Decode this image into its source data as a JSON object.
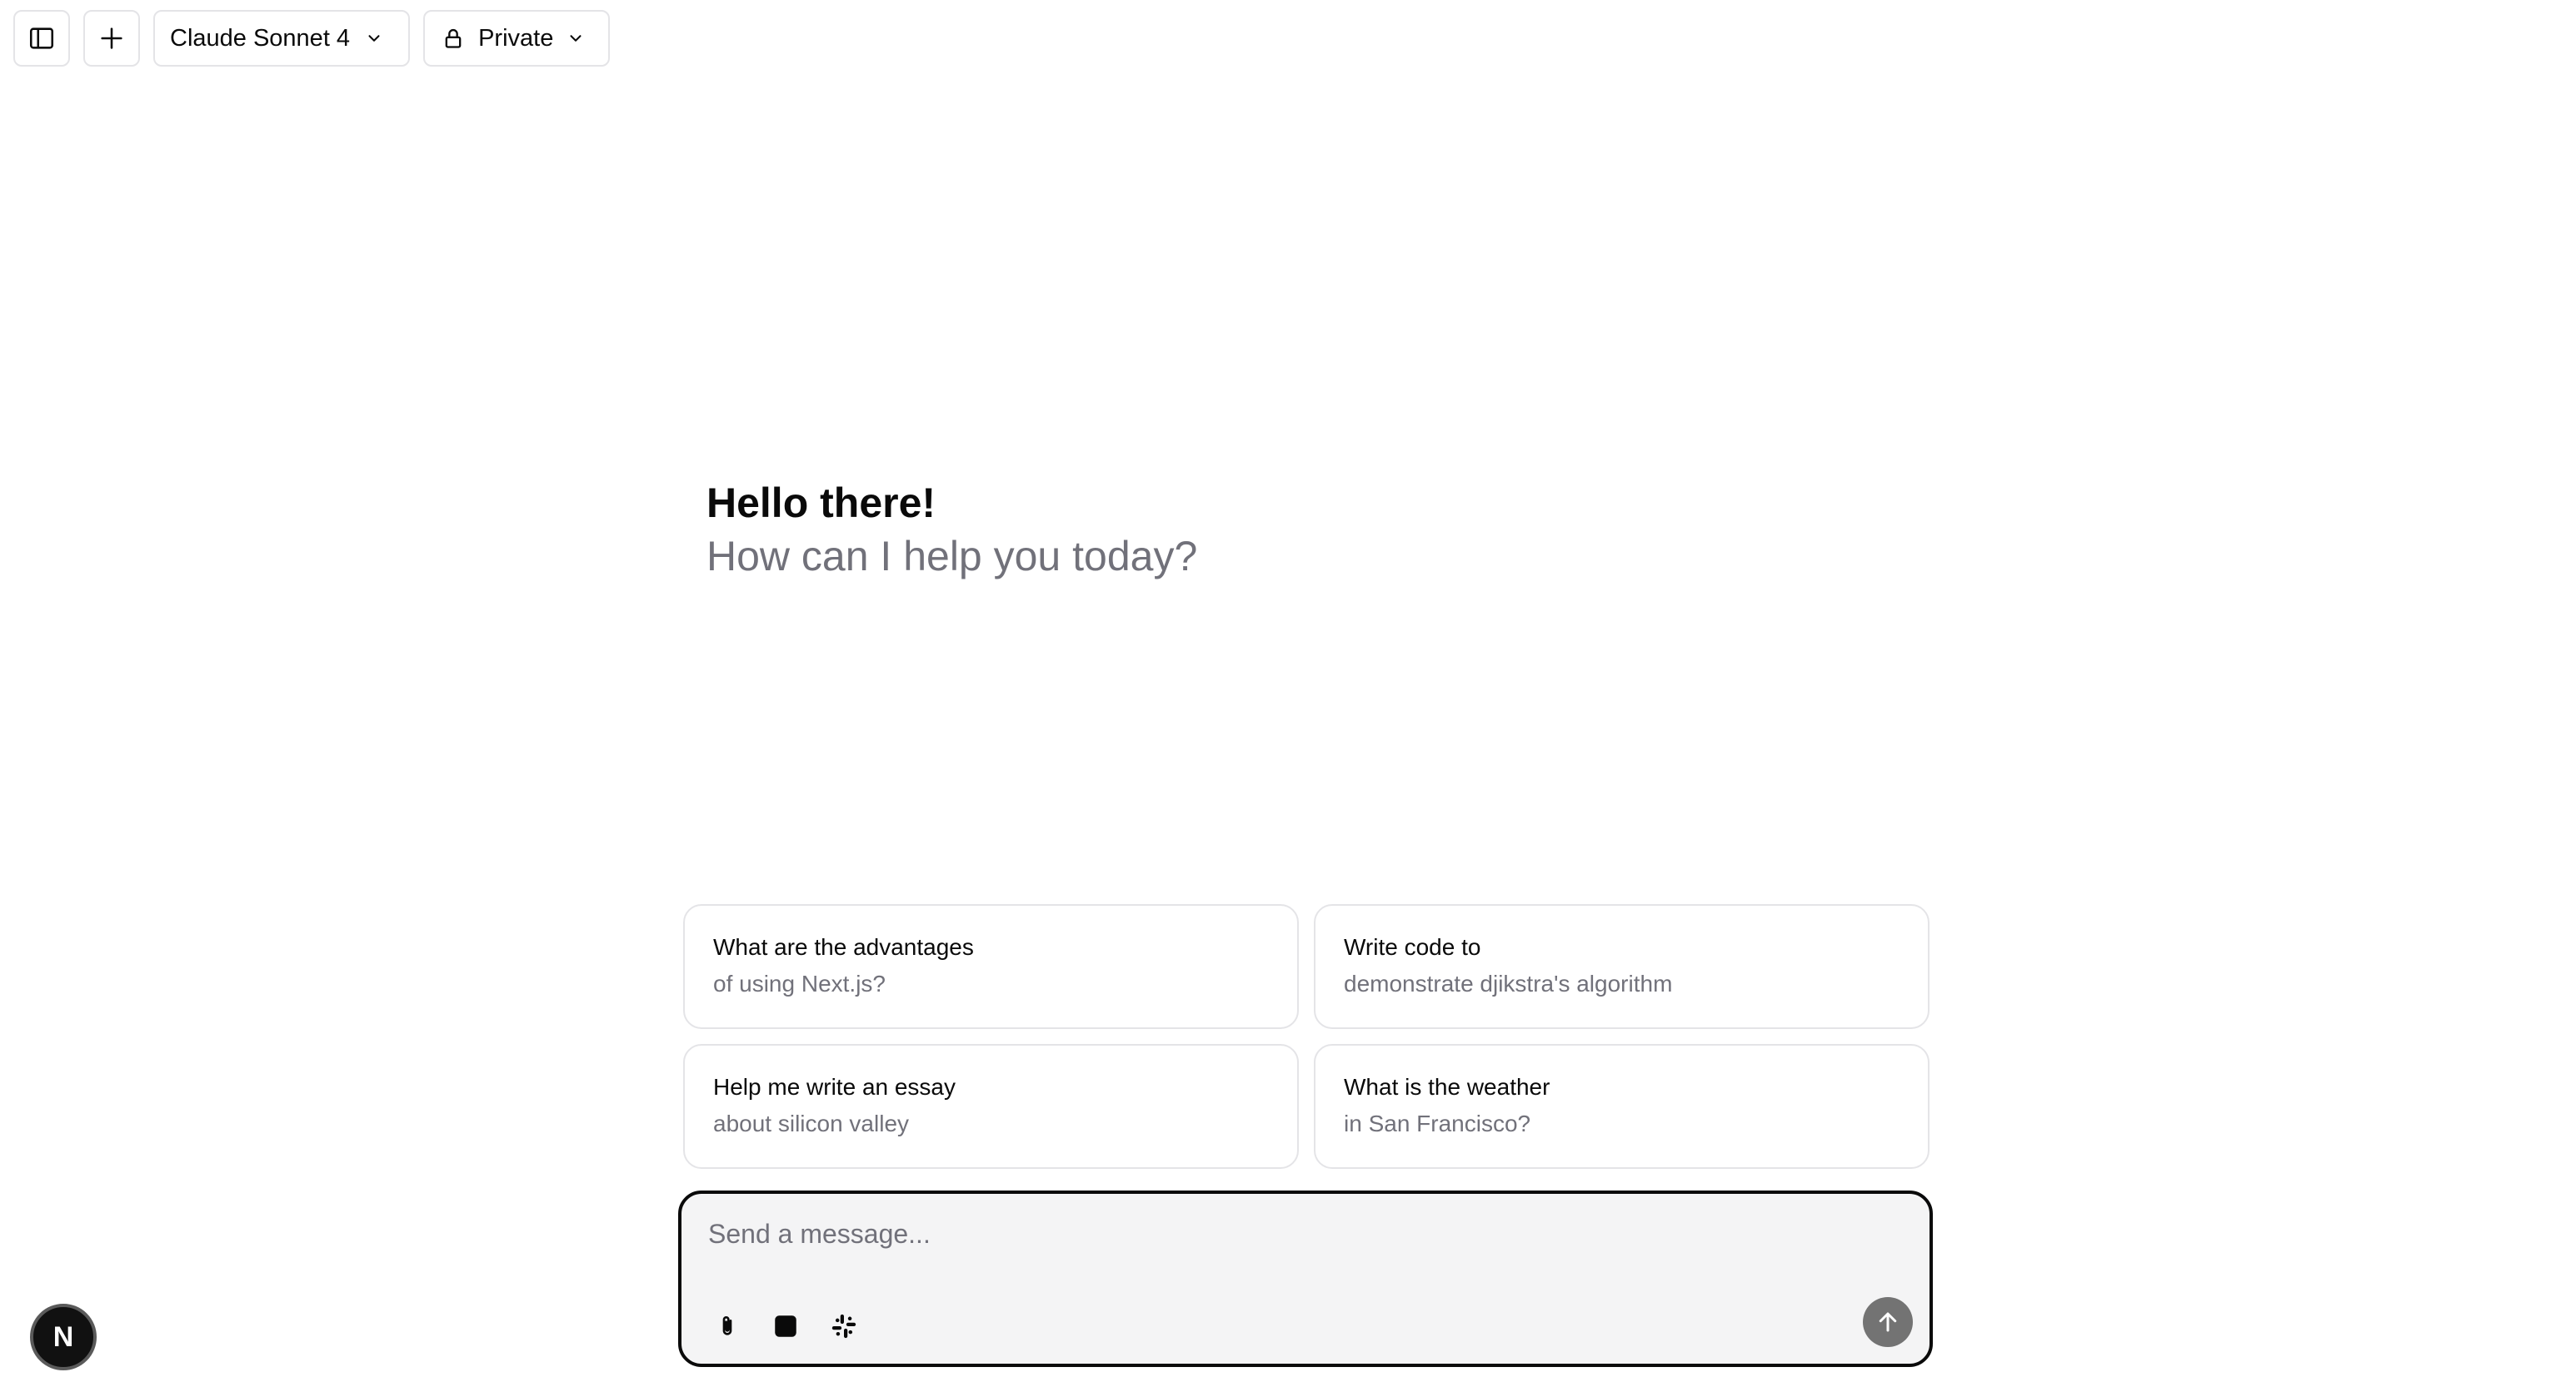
{
  "header": {
    "model_selector": {
      "label": "Claude Sonnet 4"
    },
    "visibility_selector": {
      "label": "Private"
    },
    "icons": [
      "sidebar-toggle-icon",
      "plus-icon",
      "chevron-down-icon",
      "lock-icon"
    ]
  },
  "greeting": {
    "title": "Hello there!",
    "subtitle": "How can I help you today?"
  },
  "suggestions": [
    {
      "title": "What are the advantages",
      "subtitle": "of using Next.js?"
    },
    {
      "title": "Write code to",
      "subtitle": "demonstrate djikstra's algorithm"
    },
    {
      "title": "Help me write an essay",
      "subtitle": "about silicon valley"
    },
    {
      "title": "What is the weather",
      "subtitle": "in San Francisco?"
    }
  ],
  "composer": {
    "placeholder": "Send a message...",
    "value": "",
    "tools": [
      "paperclip-icon",
      "stop-square-icon",
      "slack-icon"
    ],
    "send_icon": "arrow-up-icon"
  },
  "badge": {
    "label": "N"
  },
  "colors": {
    "border": "#e4e4e7",
    "muted_text": "#71717a",
    "composer_bg": "#f4f4f5",
    "send_button": "#737373",
    "badge_bg": "#111111"
  }
}
